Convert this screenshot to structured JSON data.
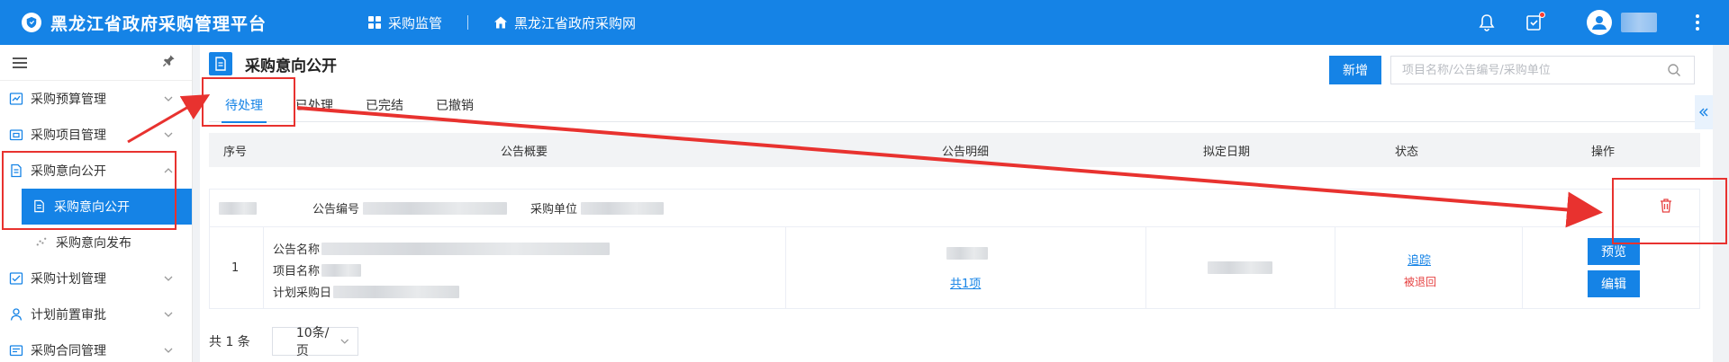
{
  "app": {
    "title": "黑龙江省政府采购管理平台",
    "nav": [
      {
        "label": "采购监管",
        "icon": "grid-icon"
      },
      {
        "label": "黑龙江省政府采购网",
        "icon": "home-icon"
      }
    ]
  },
  "sidebar": {
    "items": [
      {
        "label": "采购预算管理",
        "icon": "chart-icon"
      },
      {
        "label": "采购项目管理",
        "icon": "folder-icon"
      },
      {
        "label": "采购意向公开",
        "icon": "document-icon",
        "expanded": true
      },
      {
        "label": "采购意向公开",
        "icon": "document-icon",
        "active": true
      },
      {
        "label": "采购意向发布",
        "icon": "scatter-icon"
      },
      {
        "label": "采购计划管理",
        "icon": "checklist-icon"
      },
      {
        "label": "计划前置审批",
        "icon": "user-icon"
      },
      {
        "label": "采购合同管理",
        "icon": "contract-icon"
      }
    ]
  },
  "page": {
    "title": "采购意向公开",
    "new_button": "新增",
    "search_placeholder": "项目名称/公告编号/采购单位",
    "tabs": [
      "待处理",
      "已处理",
      "已完结",
      "已撤销"
    ],
    "active_tab": "待处理"
  },
  "table": {
    "columns": [
      "序号",
      "公告概要",
      "公告明细",
      "拟定日期",
      "状态",
      "操作"
    ],
    "group": {
      "notice_no_label": "公告编号",
      "unit_label": "采购单位"
    },
    "rows": [
      {
        "index": "1",
        "summary": {
          "notice_name_label": "公告名称",
          "project_name_label": "项目名称",
          "plan_date_label": "计划采购日"
        },
        "detail_link": "共1项",
        "status_link": "追踪",
        "status_text": "被退回",
        "actions": [
          "预览",
          "编辑"
        ]
      }
    ]
  },
  "pagination": {
    "total": "共 1 条",
    "page_size": "10条/页"
  },
  "colors": {
    "primary": "#1583e6",
    "danger": "#e64242",
    "annotation": "#e8322f"
  }
}
